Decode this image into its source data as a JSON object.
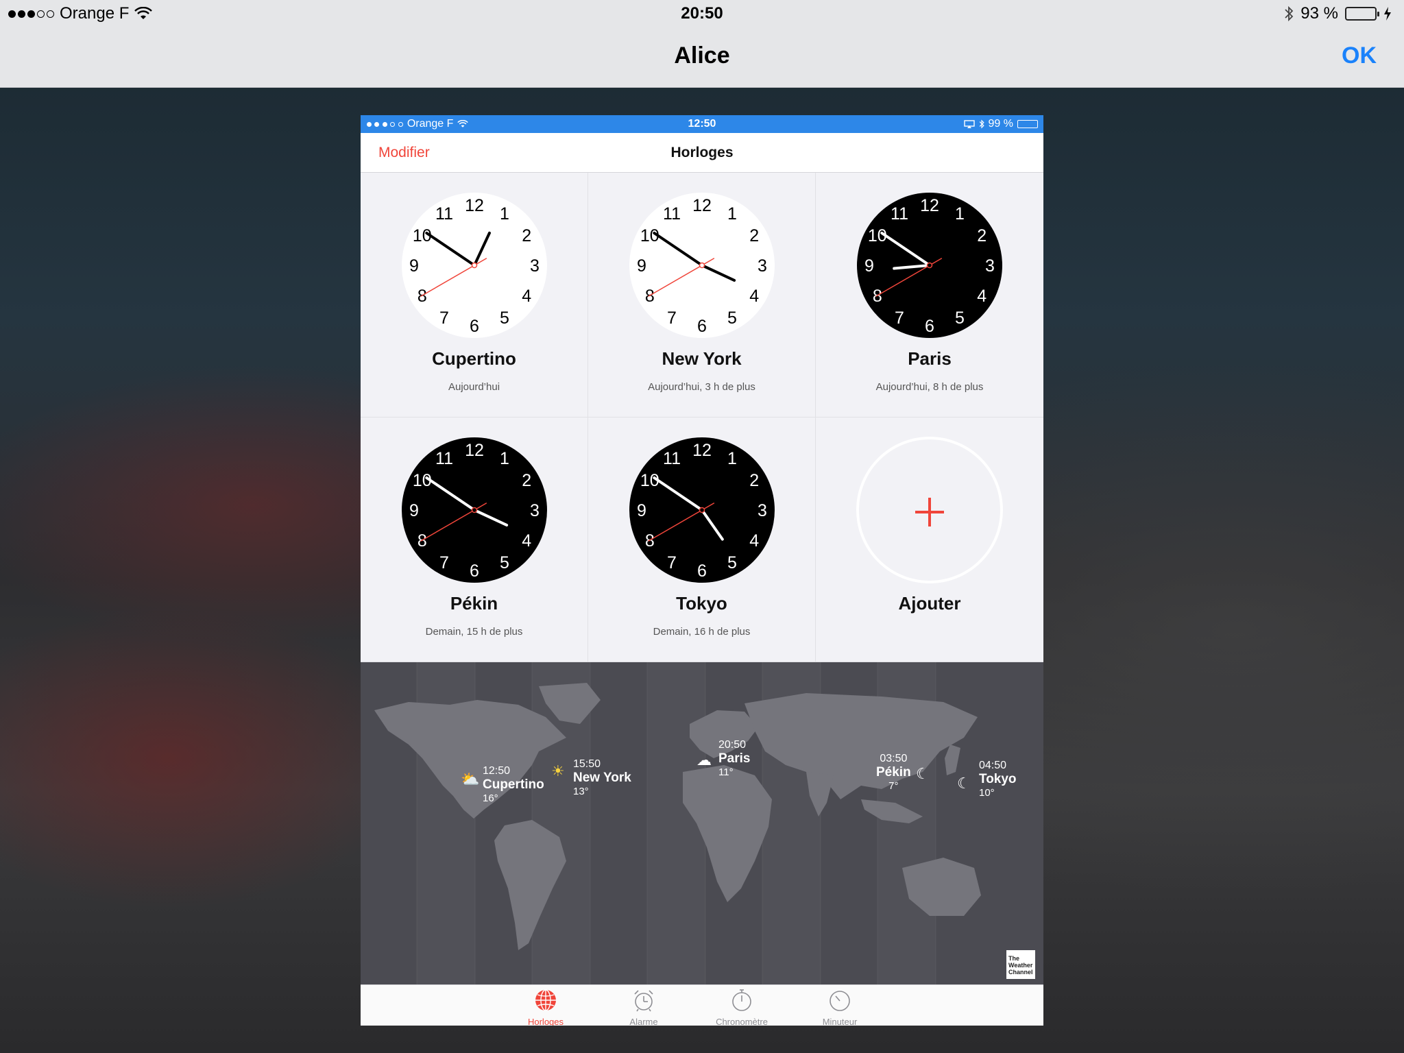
{
  "outer": {
    "status": {
      "carrier": "Orange F",
      "time": "20:50",
      "battery": "93 %",
      "battery_fill": 0.93
    },
    "nav": {
      "title": "Alice",
      "ok_label": "OK"
    }
  },
  "inner": {
    "status": {
      "carrier": "Orange F",
      "time": "12:50",
      "battery": "99 %"
    },
    "nav": {
      "edit_label": "Modifier",
      "title": "Horloges"
    },
    "clocks": [
      {
        "city": "Cupertino",
        "offset": "Aujourd’hui",
        "theme": "light",
        "hour": 12,
        "minute": 50,
        "second": 40
      },
      {
        "city": "New York",
        "offset": "Aujourd’hui, 3 h de plus",
        "theme": "light",
        "hour": 15,
        "minute": 50,
        "second": 40
      },
      {
        "city": "Paris",
        "offset": "Aujourd’hui, 8 h de plus",
        "theme": "dark",
        "hour": 20,
        "minute": 50,
        "second": 40
      },
      {
        "city": "Pékin",
        "offset": "Demain, 15 h de plus",
        "theme": "dark",
        "hour": 3,
        "minute": 50,
        "second": 40
      },
      {
        "city": "Tokyo",
        "offset": "Demain, 16 h de plus",
        "theme": "dark",
        "hour": 4,
        "minute": 50,
        "second": 40
      }
    ],
    "add_label": "Ajouter",
    "map": {
      "markers": [
        {
          "time": "12:50",
          "city": "Cupertino",
          "temp": "16°",
          "weather": "partly-cloudy-icon"
        },
        {
          "time": "15:50",
          "city": "New York",
          "temp": "13°",
          "weather": "sun-icon"
        },
        {
          "time": "20:50",
          "city": "Paris",
          "temp": "11°",
          "weather": "cloudy-night-icon"
        },
        {
          "time": "03:50",
          "city": "Pékin",
          "temp": "7°",
          "weather": "moon-icon"
        },
        {
          "time": "04:50",
          "city": "Tokyo",
          "temp": "10°",
          "weather": "moon-icon"
        }
      ],
      "attribution": "The Weather Channel"
    },
    "tabs": [
      {
        "label": "Horloges",
        "icon": "globe-icon",
        "active": true
      },
      {
        "label": "Alarme",
        "icon": "alarm-clock-icon",
        "active": false
      },
      {
        "label": "Chronomètre",
        "icon": "stopwatch-icon",
        "active": false
      },
      {
        "label": "Minuteur",
        "icon": "timer-icon",
        "active": false
      }
    ]
  },
  "colors": {
    "accent_red": "#f0453a",
    "ios_blue": "#1a82fb",
    "status_blue": "#2d87e8",
    "battery_green": "#4cd964"
  }
}
